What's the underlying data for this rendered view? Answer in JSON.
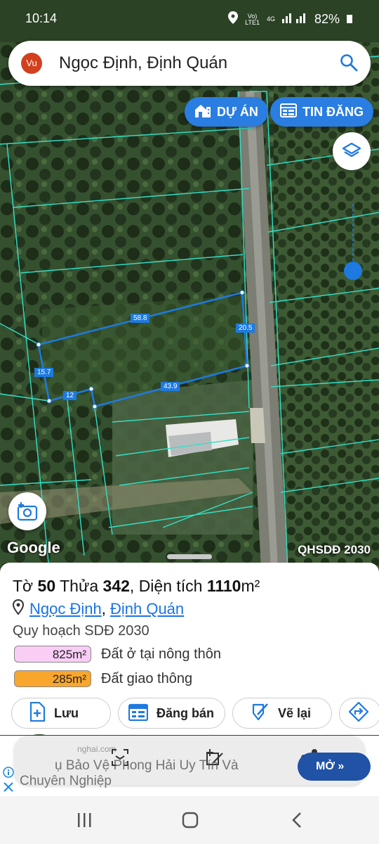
{
  "status": {
    "time": "10:14",
    "network_top": "Vo)",
    "network_bottom": "LTE1",
    "net_type": "4G",
    "battery": "82%"
  },
  "search": {
    "avatar": "Vu",
    "text": "Ngọc Định, Định Quán"
  },
  "pills": {
    "du_an": "DỰ ÁN",
    "tin_dang": "TIN ĐĂNG"
  },
  "map": {
    "attribution": "Google",
    "layer_label": "QHSDĐ 2030",
    "edges": [
      {
        "label": "58.8"
      },
      {
        "label": "20.5"
      },
      {
        "label": "43.9"
      },
      {
        "label": "15.7"
      },
      {
        "label": "12"
      }
    ],
    "colors": {
      "parcel_line": "#33e0c8",
      "selected": "#1e7ae0"
    }
  },
  "parcel": {
    "title_to_label": "Tờ",
    "to": "50",
    "thua_label": "Thửa",
    "thua": "342",
    "area_label": "Diện tích",
    "area": "1110",
    "area_unit": "m²",
    "location_1": "Ngọc Định",
    "location_sep": ",",
    "location_2": "Định Quán",
    "plan_title": "Quy hoạch SDĐ 2030",
    "land_uses": [
      {
        "area": "825m²",
        "label": "Đất ở tại nông thôn",
        "color": "#f9cdf5"
      },
      {
        "area": "285m²",
        "label": "Đất giao thông",
        "color": "#f9a62c"
      }
    ]
  },
  "actions": {
    "save": "Lưu",
    "sell": "Đăng bán",
    "redraw": "Vẽ lại"
  },
  "ad": {
    "domain": "nghai.com",
    "line1": "ụ Bảo Vệ Phong Hải Uy Tín Và",
    "line2": "Chuyên Nghiệp",
    "button": "MỞ"
  }
}
